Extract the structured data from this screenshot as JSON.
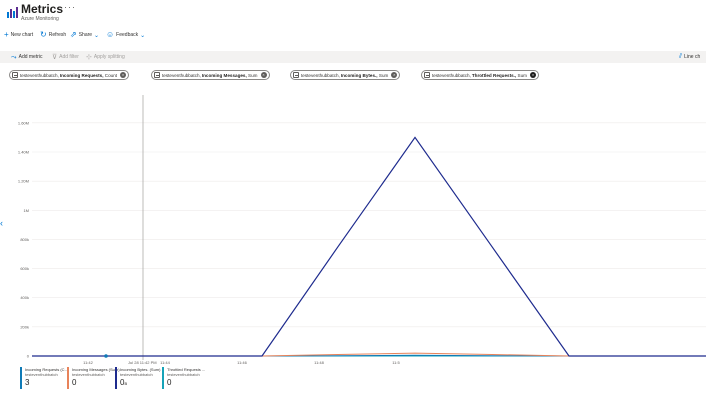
{
  "header": {
    "title": "Metrics",
    "subtitle": "Azure Monitoring",
    "more": "···"
  },
  "commands": {
    "new_chart": "New chart",
    "refresh": "Refresh",
    "share": "Share",
    "feedback": "Feedback"
  },
  "toolbar": {
    "add_metric": "Add metric",
    "add_filter": "Add filter",
    "apply_splitting": "Apply splitting",
    "chart_type": "Line ch"
  },
  "pills": [
    {
      "resource": "testeventhubbatch,",
      "metric": "Incoming Requests,",
      "aggregation": "Count"
    },
    {
      "resource": "testeventhubbatch,",
      "metric": "Incoming Messages,",
      "aggregation": "Sum"
    },
    {
      "resource": "testeventhubbatch,",
      "metric": "Incoming Bytes.,",
      "aggregation": "Sum"
    },
    {
      "resource": "testeventhubbatch,",
      "metric": "Throttled Requests.,",
      "aggregation": "Sum"
    }
  ],
  "colors": {
    "accent": "#0078d4",
    "incoming_requests": "#0f7ab6",
    "incoming_messages": "#e8835a",
    "incoming_bytes": "#1e2b8e",
    "throttled_requests": "#16a3b8"
  },
  "chart_data": {
    "type": "line",
    "y_ticks": [
      "0",
      "200k",
      "400k",
      "600k",
      "800k",
      "1M",
      "1.20M",
      "1.40M",
      "1.60M"
    ],
    "ylim": [
      0,
      1750000
    ],
    "x_ticks": [
      "11:42",
      "11:44",
      "11:46",
      "11:48",
      "11:5"
    ],
    "cursor_label": "Jul 28 11:42 PM",
    "x": [
      0,
      1,
      2,
      3,
      4,
      5,
      6,
      7,
      8,
      9,
      10,
      11
    ],
    "series": [
      {
        "name": "Incoming Bytes.",
        "color": "#1e2b8e",
        "values": [
          0,
          0,
          0,
          0,
          0,
          0,
          750000,
          1500000,
          750000,
          0,
          0,
          0
        ]
      },
      {
        "name": "Incoming Messages",
        "color": "#e8835a",
        "values": [
          0,
          0,
          0,
          0,
          0,
          0,
          10000,
          20000,
          10000,
          0,
          0,
          0
        ]
      },
      {
        "name": "Incoming Requests",
        "color": "#0f7ab6",
        "values": [
          0,
          0,
          0,
          0,
          0,
          0,
          2000,
          5000,
          2000,
          0,
          0,
          0
        ]
      },
      {
        "name": "Throttled Requests.",
        "color": "#16a3b8",
        "values": [
          0,
          0,
          0,
          0,
          0,
          0,
          0,
          0,
          0,
          0,
          0,
          0
        ]
      }
    ]
  },
  "legend": [
    {
      "name": "Incoming Requests (C...",
      "resource": "testeventhubbatch",
      "value": "3",
      "color": "#0f7ab6"
    },
    {
      "name": "Incoming Messages (Sum)",
      "resource": "testeventhubbatch",
      "value": "0",
      "color": "#e8835a"
    },
    {
      "name": "Incoming Bytes. (Sum)",
      "resource": "testeventhubbatch",
      "value": "0",
      "unit": "B",
      "color": "#1e2b8e"
    },
    {
      "name": "Throttled Requests ...",
      "resource": "testeventhubbatch",
      "value": "0",
      "color": "#16a3b8"
    }
  ]
}
